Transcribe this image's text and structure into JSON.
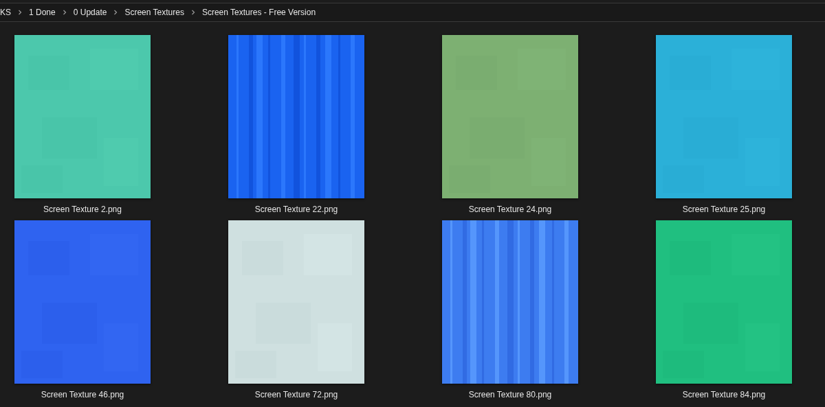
{
  "breadcrumb": [
    {
      "label": "KS"
    },
    {
      "label": "1 Done"
    },
    {
      "label": "0 Update"
    },
    {
      "label": "Screen Textures"
    },
    {
      "label": "Screen Textures - Free Version"
    }
  ],
  "files": [
    {
      "name": "Screen Texture 2.png",
      "kind": "picture"
    },
    {
      "name": "Screen Texture 22.png",
      "kind": "picture"
    },
    {
      "name": "Screen Texture 24.png",
      "kind": "picture"
    },
    {
      "name": "Screen Texture 25.png",
      "kind": "picture"
    },
    {
      "name": "Screen Texture 46.png",
      "kind": "picture"
    },
    {
      "name": "Screen Texture 72.png",
      "kind": "picture"
    },
    {
      "name": "Screen Texture 80.png",
      "kind": "picture"
    },
    {
      "name": "Screen Texture 84.png",
      "kind": "picture"
    }
  ]
}
